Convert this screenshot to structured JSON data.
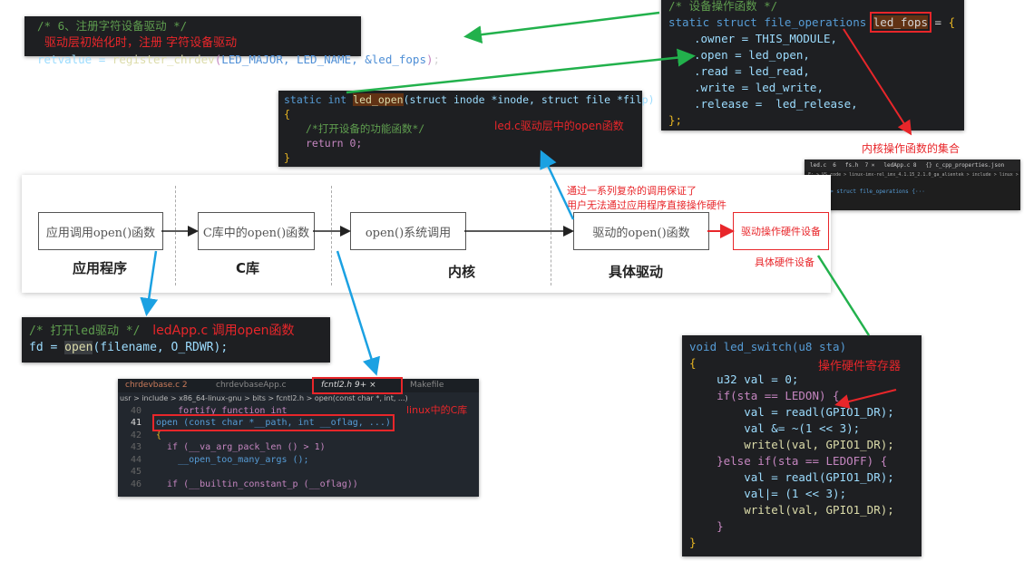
{
  "register": {
    "comment": "/* 6、注册字符设备驱动 */",
    "note": "驱动层初始化时，注册 字符设备驱动",
    "code_a": "retvalue = ",
    "code_fn": "register_chrdev",
    "code_args": "LED_MAJOR, LED_NAME, &led_fops"
  },
  "fops": {
    "comment": "/* 设备操作函数 */",
    "decl": "static struct file_operations ",
    "name": "led_fops",
    "lines": [
      ".owner = THIS_MODULE,",
      ".open = led_open,",
      ".read = led_read,",
      ".write = led_write,",
      ".release =  led_release,"
    ],
    "end": "};",
    "note": "内核操作函数的集合"
  },
  "ledopen": {
    "sig": "static int ",
    "name": "led_open",
    "args": "(struct inode *inode, struct file *filp)",
    "open_brace": "{",
    "comment": "/*打开设备的功能函数*/",
    "ret": "return 0;",
    "close_brace": "}",
    "note": "led.c驱动层中的open函数"
  },
  "fsh": {
    "tabs": [
      "led.c  6",
      "fs.h  7 ×",
      "ledApp.c 8",
      "{} c_cpp_properties.json"
    ],
    "path": "F: > VS_code > linux-imx-rel_imx_4.1.15_2.1.0_ga_alientek > include > linux > C fs.h",
    "lines": [
      {
        "n": "1587",
        "t": ""
      },
      {
        "n": "1588",
        "t": "> struct file_operations {···"
      },
      {
        "n": "1622",
        "t": ""
      }
    ]
  },
  "diagram": {
    "boxes": [
      "应用调用open()函数",
      "C库中的open()函数",
      "open()系统调用",
      "驱动的open()函数"
    ],
    "hw_box": "驱动操作硬件设备",
    "layers": [
      "应用程序",
      "C库",
      "内核",
      "具体驱动"
    ],
    "hw_label": "具体硬件设备",
    "note_1": "通过一系列复杂的调用保证了",
    "note_2": "用户无法通过应用程序直接操作硬件"
  },
  "ledapp": {
    "comment": "/* 打开led驱动 */",
    "note": "ledApp.c 调用open函数",
    "code_a": "fd = ",
    "code_fn": "open",
    "code_args": "(filename, O_RDWR);"
  },
  "fcntl": {
    "tabs": [
      "chrdevbase.c 2",
      "chrdevbaseApp.c",
      "fcntl2.h 9+ ×",
      "Makefile"
    ],
    "breadcrumb": "usr > include > x86_64-linux-gnu > bits > fcntl2.h > open(const char *, int, ...)",
    "note": "linux中的C库",
    "lines": [
      {
        "n": "40",
        "t": "  __fortify_function int"
      },
      {
        "n": "41",
        "t": "open (const char *__path, int __oflag, ...)"
      },
      {
        "n": "42",
        "t": "{"
      },
      {
        "n": "43",
        "t": "  if (__va_arg_pack_len () > 1)"
      },
      {
        "n": "44",
        "t": "    __open_too_many_args ();"
      },
      {
        "n": "45",
        "t": ""
      },
      {
        "n": "46",
        "t": "  if (__builtin_constant_p (__oflag))"
      }
    ]
  },
  "ledswitch": {
    "note": "操作硬件寄存器",
    "lines": [
      "void led_switch(u8 sta)",
      "{",
      "    u32 val = 0;",
      "    if(sta == LEDON) {",
      "        val = readl(GPIO1_DR);",
      "        val &= ~(1 << 3);",
      "        writel(val, GPIO1_DR);",
      "    }else if(sta == LEDOFF) {",
      "        val = readl(GPIO1_DR);",
      "        val|= (1 << 3);",
      "        writel(val, GPIO1_DR);",
      "    }",
      "}"
    ]
  },
  "colors": {
    "arrow_green": "#22b14c",
    "arrow_red": "#e8262a",
    "arrow_blue": "#1ba1e2"
  }
}
